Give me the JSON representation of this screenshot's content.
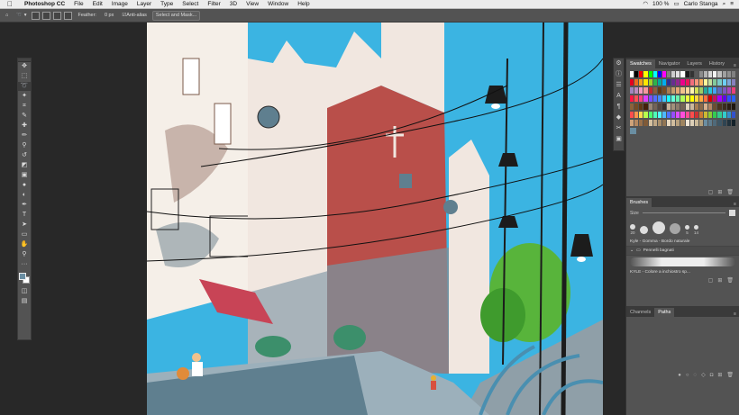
{
  "menubar": {
    "apple_icon": "apple-icon",
    "app_name": "Photoshop CC",
    "menus": [
      "File",
      "Edit",
      "Image",
      "Layer",
      "Type",
      "Select",
      "Filter",
      "3D",
      "View",
      "Window",
      "Help"
    ],
    "battery": "100 %",
    "user": "Carlo Stanga"
  },
  "options": {
    "feather_label": "Feather:",
    "feather_value": "0 px",
    "antialias_label": "Anti-alias",
    "select_mask_label": "Select and Mask..."
  },
  "panels": {
    "top_tabs": [
      "Swatches",
      "Navigator",
      "Layers",
      "History"
    ],
    "brushes_tab": "Brushes",
    "size_label": "Size",
    "brush_sizes": [
      "20",
      "",
      "",
      "",
      "5",
      "14"
    ],
    "current_brush": "Kyle - Gomma - Bordo naturale",
    "folder_name": "Pennelli bagnati",
    "stroke_brush": "KYLE - Colore a inchiostro sp...",
    "bottom_tabs": [
      "Channels",
      "Paths"
    ]
  },
  "swatches": [
    [
      "#ffffff",
      "#000000",
      "#ff0000",
      "#ffff00",
      "#00ff00",
      "#00ffff",
      "#0000ff",
      "#ff00ff",
      "#7f7f7f",
      "#cccccc",
      "#e0e0e0",
      "#ffffff",
      "#1a1a1a",
      "#333333",
      "#595959",
      "#8c8c8c",
      "#b3b3b3",
      "#d9d9d9",
      "#f2f2f2",
      "#c0c0c0",
      "#a0a0a0",
      "#909090",
      "#808080"
    ],
    [
      "#e5001e",
      "#ed6b1d",
      "#f4a41c",
      "#ffe600",
      "#9ed52b",
      "#2cb34a",
      "#00a99d",
      "#00aeef",
      "#2e3192",
      "#662d91",
      "#92278f",
      "#ec008c",
      "#ed145b",
      "#f26d7d",
      "#f7977a",
      "#fbaf5d",
      "#fff799",
      "#c4df9b",
      "#82ca9c",
      "#7accc8",
      "#6dcff6",
      "#7da7d9",
      "#8781bd"
    ],
    [
      "#a186be",
      "#bd8cbf",
      "#f49ac1",
      "#f5989d",
      "#c1272d",
      "#8b5e3c",
      "#603913",
      "#754c24",
      "#a67c52",
      "#c69c6d",
      "#e6a774",
      "#f1c28c",
      "#ffd89b",
      "#fff3b0",
      "#d4e157",
      "#9ccc65",
      "#26a69a",
      "#26c6da",
      "#42a5f5",
      "#5c6bc0",
      "#7e57c2",
      "#ab47bc",
      "#ec407a"
    ],
    [
      "#ff1744",
      "#ff5252",
      "#ff4081",
      "#e040fb",
      "#7c4dff",
      "#536dfe",
      "#448aff",
      "#40c4ff",
      "#18ffff",
      "#64ffda",
      "#69f0ae",
      "#b2ff59",
      "#eeff41",
      "#ffff00",
      "#ffd740",
      "#ffab40",
      "#ff6e40",
      "#d50000",
      "#c51162",
      "#aa00ff",
      "#6200ea",
      "#304ffe",
      "#2962ff"
    ],
    [
      "#8c6239",
      "#754c24",
      "#603913",
      "#42210b",
      "#998675",
      "#736357",
      "#534741",
      "#362f2d",
      "#c7b299",
      "#a3917b",
      "#8c7b6b",
      "#736357",
      "#e1d3c0",
      "#cbb89d",
      "#a67c52",
      "#8b6a4a",
      "#d8b08c",
      "#b38664",
      "#6b4e31",
      "#4a3520",
      "#3b2c1e",
      "#2a1f15",
      "#1f1710"
    ],
    [
      "#ff4d4d",
      "#ff944d",
      "#ffdb4d",
      "#b8ff4d",
      "#4dff71",
      "#4dffb8",
      "#4dffff",
      "#4db8ff",
      "#4d71ff",
      "#944dff",
      "#db4dff",
      "#ff4ddb",
      "#ff4d94",
      "#ff4d4d",
      "#cc3333",
      "#cc7a33",
      "#ccb833",
      "#8fcc33",
      "#33cc52",
      "#33cc8f",
      "#33cccc",
      "#338fcc",
      "#3352cc"
    ],
    [
      "#cfa37a",
      "#b58860",
      "#9a7049",
      "#7f5a37",
      "#d6c1a0",
      "#bfa785",
      "#a88e6b",
      "#917553",
      "#e8d9c1",
      "#d0bd9e",
      "#b7a07d",
      "#9e845f",
      "#f0e6d6",
      "#ddd0b8",
      "#c9b898",
      "#b4a07a",
      "#6a8ea2",
      "#5f7d8f",
      "#4f6a7a",
      "#3f5766",
      "#2f4452",
      "#21323d",
      "#14222a"
    ],
    [
      "#6a8ea2"
    ]
  ],
  "canvas_colors": {
    "sky": "#3bb4e2",
    "church_red": "#b94f4a",
    "stone": "#f1e7e0",
    "shadow": "#7e8e99",
    "wall": "#5f7f8f",
    "awning": "#c84456",
    "tree": "#58b43b"
  }
}
